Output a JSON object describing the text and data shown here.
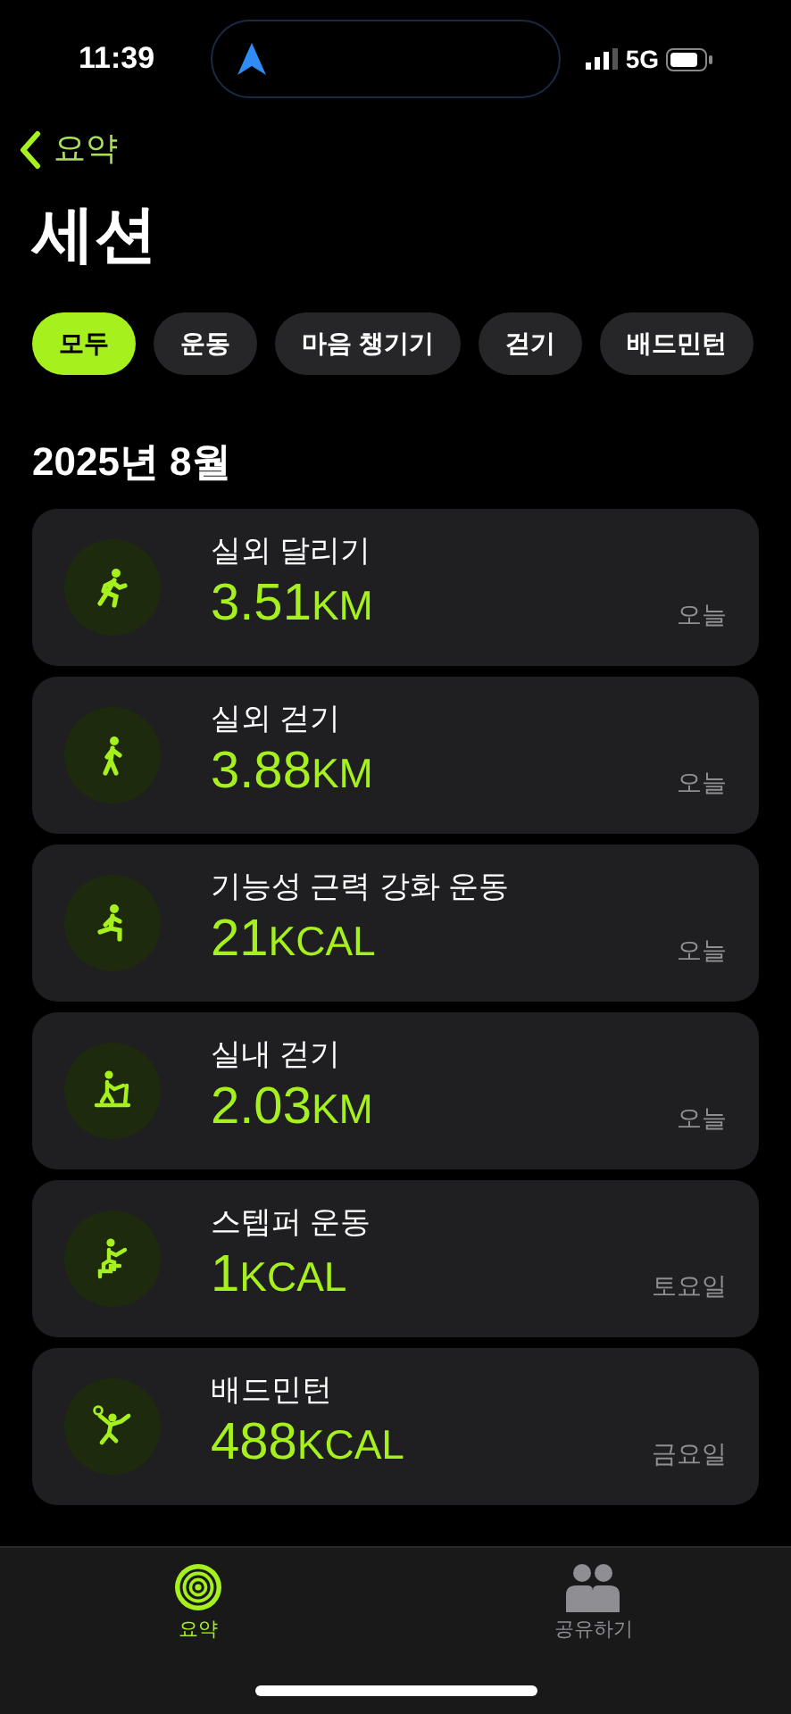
{
  "status_bar": {
    "time": "11:39",
    "network": "5G"
  },
  "nav": {
    "back_label": "요약",
    "title": "세션"
  },
  "filters": [
    {
      "label": "모두",
      "selected": true
    },
    {
      "label": "운동",
      "selected": false
    },
    {
      "label": "마음 챙기기",
      "selected": false
    },
    {
      "label": "걷기",
      "selected": false
    },
    {
      "label": "배드민턴",
      "selected": false
    }
  ],
  "section_title": "2025년 8월",
  "sessions": [
    {
      "kind": "run",
      "name": "실외 달리기",
      "value": "3.51",
      "unit": "KM",
      "day": "오늘"
    },
    {
      "kind": "walk",
      "name": "실외 걷기",
      "value": "3.88",
      "unit": "KM",
      "day": "오늘"
    },
    {
      "kind": "strength",
      "name": "기능성 근력 강화 운동",
      "value": "21",
      "unit": "KCAL",
      "day": "오늘"
    },
    {
      "kind": "treadmill",
      "name": "실내 걷기",
      "value": "2.03",
      "unit": "KM",
      "day": "오늘"
    },
    {
      "kind": "stepper",
      "name": "스텝퍼 운동",
      "value": "1",
      "unit": "KCAL",
      "day": "토요일"
    },
    {
      "kind": "badminton",
      "name": "배드민턴",
      "value": "488",
      "unit": "KCAL",
      "day": "금요일"
    }
  ],
  "tab_bar": [
    {
      "kind": "summary",
      "label": "요약",
      "selected": true
    },
    {
      "kind": "sharing",
      "label": "공유하기",
      "selected": false
    }
  ]
}
